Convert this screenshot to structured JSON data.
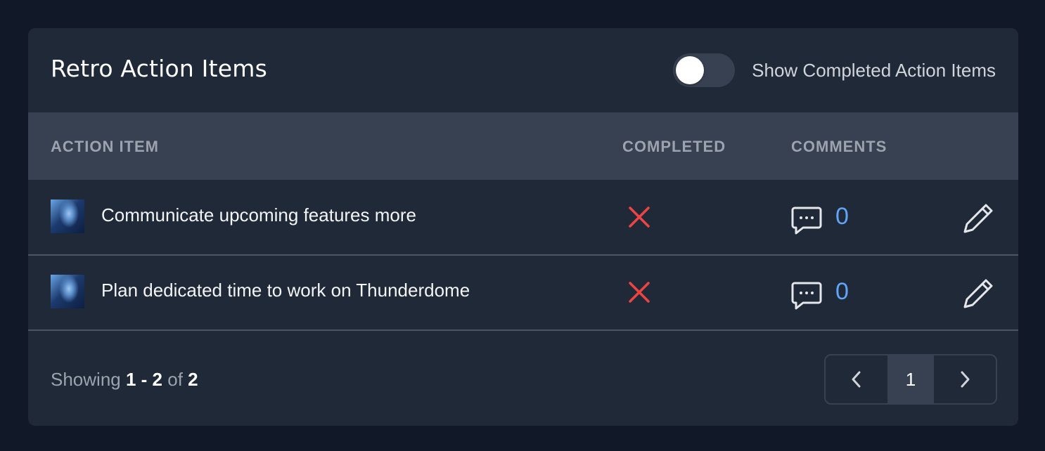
{
  "header": {
    "title": "Retro Action Items",
    "toggle_label": "Show Completed Action Items",
    "toggle_on": false
  },
  "table": {
    "columns": [
      "ACTION ITEM",
      "COMPLETED",
      "COMMENTS"
    ],
    "rows": [
      {
        "text": "Communicate upcoming features more",
        "completed": false,
        "comments": "0"
      },
      {
        "text": "Plan dedicated time to work on Thunderdome",
        "completed": false,
        "comments": "0"
      }
    ]
  },
  "footer": {
    "showing_prefix": "Showing",
    "range": "1 - 2",
    "of": "of",
    "total": "2",
    "current_page": "1"
  },
  "colors": {
    "page_bg": "#111827",
    "card_bg": "#1f2937",
    "header_row_bg": "#374151",
    "not_completed": "#ef4444",
    "comment_count": "#60a5fa"
  },
  "icons": {
    "completed_status": "x-icon",
    "comments": "comment-icon",
    "edit": "pencil-icon",
    "prev": "chevron-left-icon",
    "next": "chevron-right-icon"
  }
}
